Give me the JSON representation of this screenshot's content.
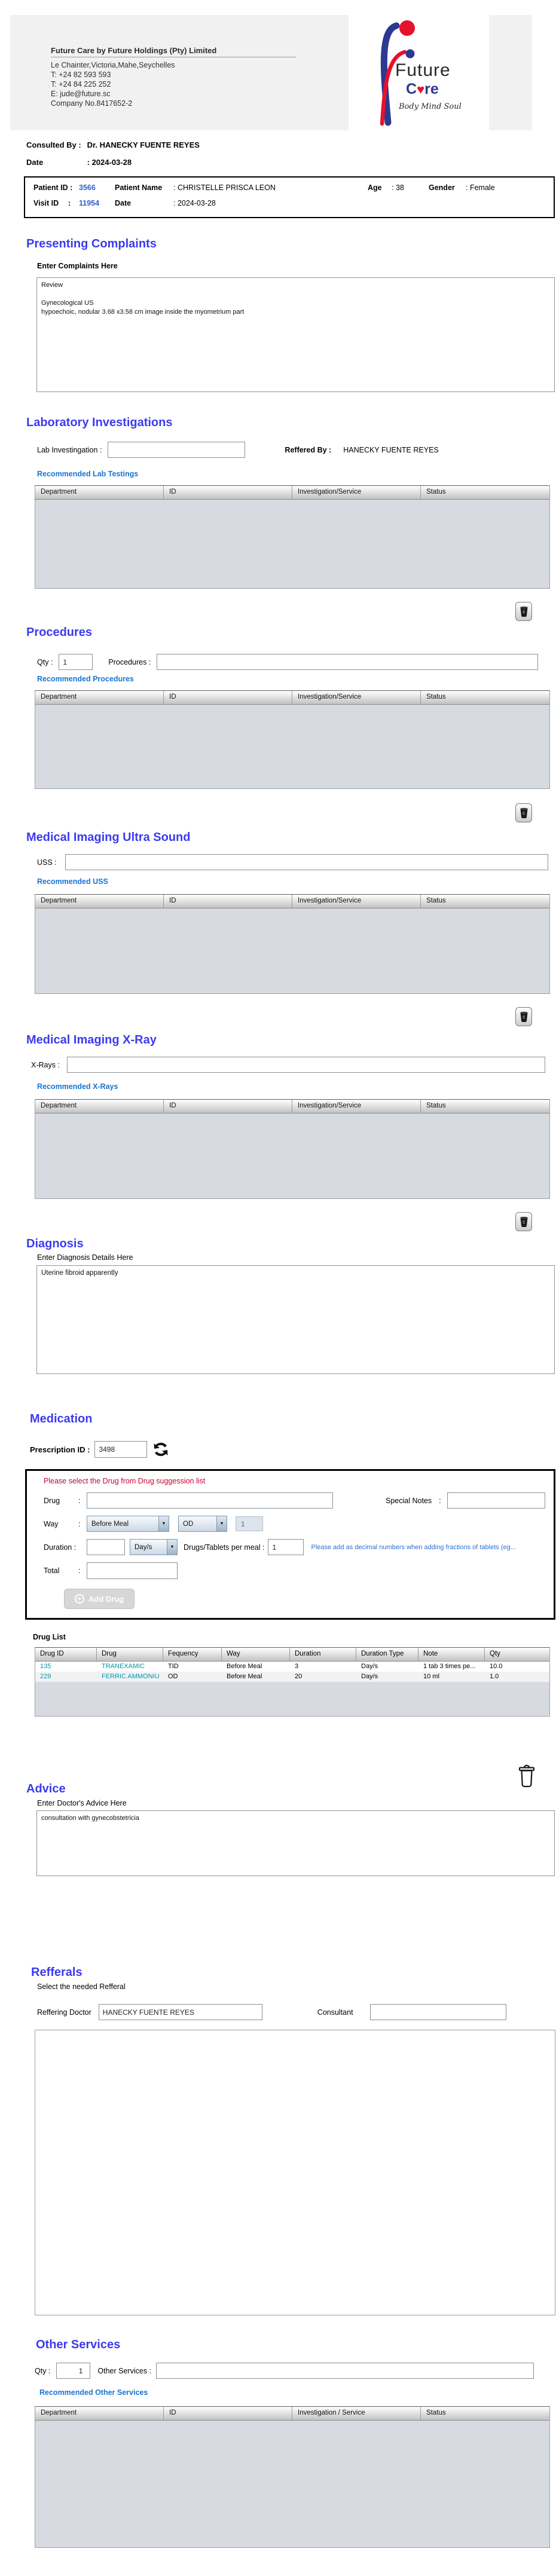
{
  "company": {
    "name": "Future Care by Future Holdings (Pty) Limited",
    "address": "Le Chainter,Victoria,Mahe,Seychelles",
    "phone1": "T: +24  82 593 593",
    "phone2": "T: +24  84 225 252",
    "email": "E: jude@future.sc",
    "company_no": "Company No.8417652-2"
  },
  "logo": {
    "brand_top": "Future",
    "care_pre": "C",
    "heart": "♥",
    "care_post": "re",
    "tagline": "Body Mind Soul"
  },
  "consultation": {
    "consulted_by_label": "Consulted By :",
    "consulted_by_value": "Dr.  HANECKY FUENTE REYES",
    "date_label": "Date",
    "date_value": ": 2024-03-28"
  },
  "patient": {
    "id_label": "Patient ID :",
    "id": "3566",
    "name_label": "Patient Name",
    "name_value": ": CHRISTELLE PRISCA LEON",
    "age_label": "Age",
    "age_value": ":  38",
    "gender_label": "Gender",
    "gender_value": ":  Female",
    "visit_label": "Visit ID",
    "visit_colon": ":",
    "visit_id": "11954",
    "date_label": "Date",
    "date_value": ": 2024-03-28"
  },
  "complaints": {
    "title": "Presenting Complaints",
    "sublabel": "Enter Complaints Here",
    "text": "Review\n\nGynecological US\nhypoechoic, nodular 3.68 x3.58 cm image inside the myometrium part"
  },
  "lab": {
    "title": "Laboratory  Investigations",
    "field_label": "Lab Investingation :",
    "field_value": "",
    "reffered_by_label": "Reffered By :",
    "reffered_by_value": "HANECKY FUENTE REYES",
    "link": "Recommended Lab Testings",
    "headers": [
      "Department",
      "ID",
      "Investigation/Service",
      "Status"
    ]
  },
  "procedures": {
    "title": "Procedures",
    "qty_label": "Qty :",
    "qty_value": "1",
    "field_label": "Procedures :",
    "field_value": "",
    "link": "Recommended Procedures",
    "headers": [
      "Department",
      "ID",
      "Investigation/Service",
      "Status"
    ]
  },
  "uss": {
    "title": "Medical Imaging Ultra Sound",
    "field_label": "USS :",
    "field_value": "",
    "link": "Recommended USS",
    "headers": [
      "Department",
      "ID",
      "Investigation/Service",
      "Status"
    ]
  },
  "xray": {
    "title": "Medical Imaging X-Ray",
    "field_label": "X-Rays :",
    "field_value": "",
    "link": "Recommended X-Rays",
    "headers": [
      "Department",
      "ID",
      "Investigation/Service",
      "Status"
    ]
  },
  "diagnosis": {
    "title": "Diagnosis",
    "sublabel": "Enter Diagnosis Details Here",
    "text": "Uterine fibroid apparently"
  },
  "medication": {
    "title": "Medication",
    "prescription_label": "Prescription ID :",
    "prescription_id": "3498",
    "warning": "Please select the Drug from Drug suggession list",
    "drug_label": "Drug",
    "colon": ":",
    "special_notes_label": "Special Notes",
    "way_label": "Way",
    "way_value": "Before Meal",
    "frequency_value": "OD",
    "frequency_qty": "1",
    "duration_label": "Duration :",
    "duration_value": "",
    "duration_type_value": "Day/s",
    "per_meal_label": "Drugs/Tablets per meal :",
    "per_meal_value": "1",
    "fraction_note": "Please add as decimal numbers when adding fractions of tablets (eg...",
    "total_label": "Total",
    "total_value": "",
    "add_drug_label": "Add Drug",
    "drug_list_label": "Drug List",
    "table": {
      "headers": [
        "Drug ID",
        "Drug",
        "Fequency",
        "Way",
        "Duration",
        "Duration Type",
        "Note",
        "Qty"
      ],
      "rows": [
        {
          "id": "135",
          "drug": "TRANEXAMIC",
          "frequency": "TID",
          "way": "Before Meal",
          "duration": "3",
          "duration_type": "Day/s",
          "note": "1 tab 3 times pe...",
          "qty": "10.0"
        },
        {
          "id": "229",
          "drug": "FERRIC AMMONIU",
          "frequency": "OD",
          "way": "Before Meal",
          "duration": "20",
          "duration_type": "Day/s",
          "note": "10 ml",
          "qty": "1.0"
        }
      ]
    }
  },
  "advice": {
    "title": "Advice",
    "sublabel": "Enter Doctor's Advice Here",
    "text": "consultation with gynecobstetricia"
  },
  "refferals": {
    "title": "Refferals",
    "sublabel": "Select the needed Refferal",
    "doctor_label": "Reffering Doctor",
    "doctor_value": "HANECKY FUENTE REYES",
    "consultant_label": "Consultant",
    "consultant_value": ""
  },
  "other_services": {
    "title": "Other Services",
    "qty_label": "Qty :",
    "qty_value": "1",
    "field_label": "Other Services :",
    "field_value": "",
    "link": "Recommended Other Services",
    "headers": [
      "Department",
      "ID",
      "Investigation / Service",
      "Status"
    ]
  },
  "colors": {
    "heading": "#3b3bee",
    "link": "#1874d2",
    "warning": "#cc0033",
    "drug_teal": "#0097a7",
    "id_blue": "#2f62cc"
  }
}
